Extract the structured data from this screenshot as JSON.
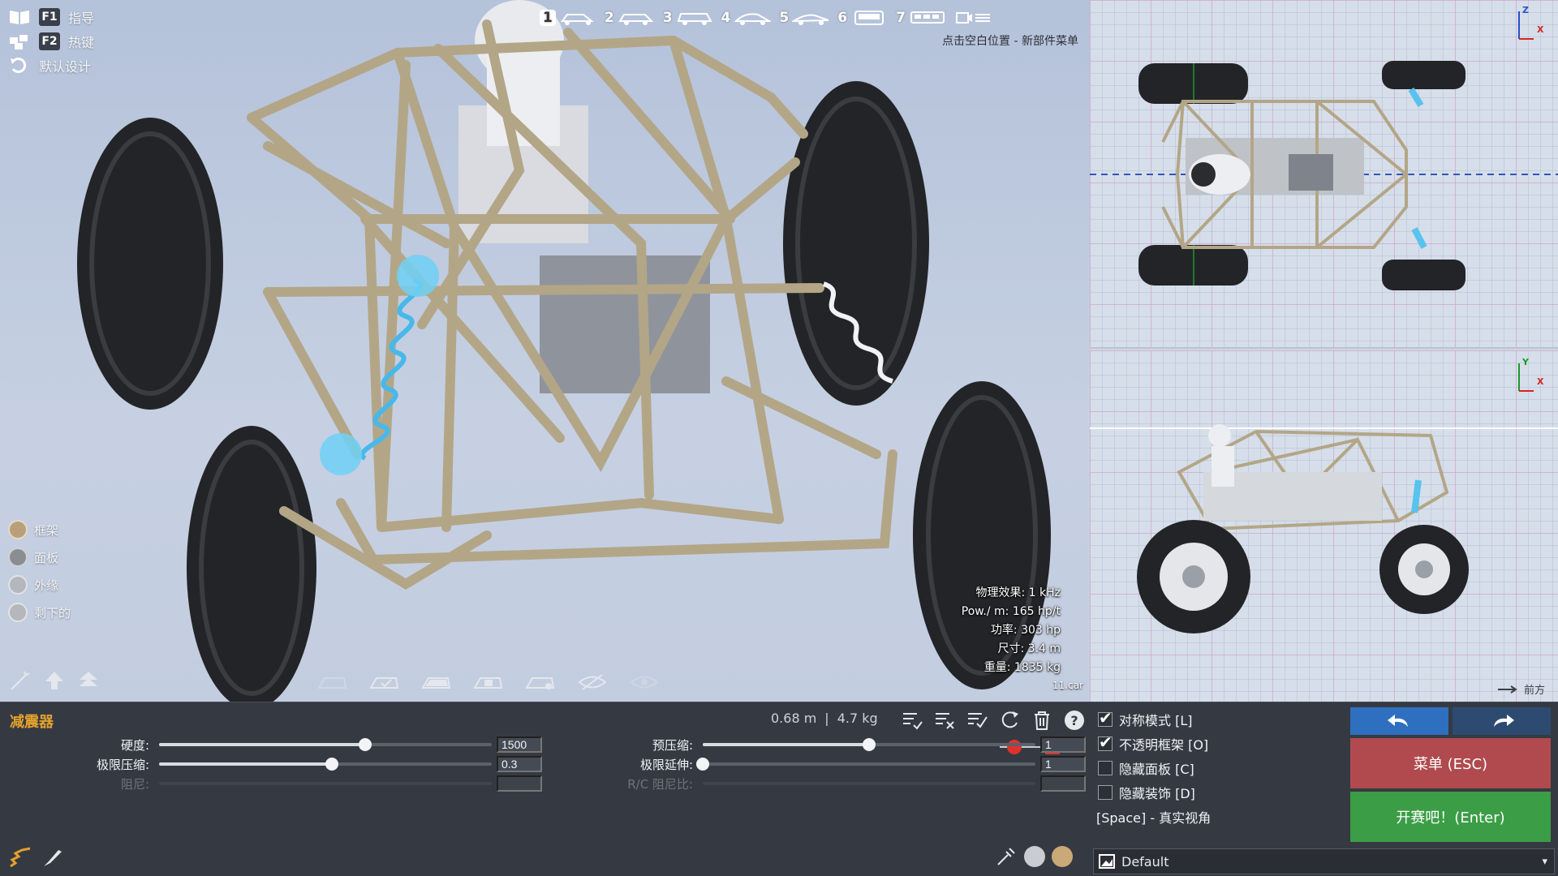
{
  "topleft": {
    "items": [
      {
        "key": "F1",
        "label": "指导"
      },
      {
        "key": "F2",
        "label": "热键"
      },
      {
        "key": "",
        "label": "默认设计"
      }
    ]
  },
  "vehicle_tabs": [
    {
      "num": "1",
      "icon": "buggy-icon"
    },
    {
      "num": "2",
      "icon": "sedan-icon"
    },
    {
      "num": "3",
      "icon": "wagon-icon"
    },
    {
      "num": "4",
      "icon": "coupe-icon"
    },
    {
      "num": "5",
      "icon": "sports-car-icon"
    },
    {
      "num": "6",
      "icon": "truck-front-icon"
    },
    {
      "num": "7",
      "icon": "bus-icon"
    }
  ],
  "hint_text": "点击空白位置 - 新部件菜单",
  "layers": [
    {
      "label": "框架",
      "color": "#b9a07a"
    },
    {
      "label": "面板",
      "color": "#8a8d92"
    },
    {
      "label": "外缘",
      "color": "#b4b7bb"
    },
    {
      "label": "剩下的",
      "color": "#b4b7bb"
    }
  ],
  "stats": [
    {
      "label": "物理效果:",
      "value": "1 kHz"
    },
    {
      "label": "Pow./ m:",
      "value": "165 hp/t"
    },
    {
      "label": "功率:",
      "value": "303 hp"
    },
    {
      "label": "尺寸:",
      "value": "3.4 m"
    },
    {
      "label": "重量:",
      "value": "1835 kg"
    }
  ],
  "filename": "11.car",
  "view_labels": {
    "top_axes": [
      "Z",
      "X"
    ],
    "side_axes": [
      "Y",
      "X"
    ],
    "forward": "前方"
  },
  "panel": {
    "title": "减震器",
    "length": "0.68 m",
    "separator": "|",
    "mass": "4.7 kg",
    "sliders_left": [
      {
        "label": "硬度:",
        "value": "1500",
        "level": 0.62,
        "enabled": true
      },
      {
        "label": "极限压缩:",
        "value": "0.3",
        "level": 0.52,
        "enabled": true
      },
      {
        "label": "阻尼:",
        "value": "",
        "level": 0,
        "enabled": false
      }
    ],
    "sliders_right": [
      {
        "label": "预压缩:",
        "value": "1",
        "level": 0.5,
        "enabled": true
      },
      {
        "label": "极限延伸:",
        "value": "1",
        "level": 0.0,
        "enabled": true
      },
      {
        "label": "R/C 阻尼比:",
        "value": "",
        "level": 0,
        "enabled": false
      }
    ],
    "colors": {
      "accent": "#e2a02e",
      "red": "#e0322b",
      "green": "#3b9d45",
      "blue": "#2e6fc0",
      "menu": "#b04a4e"
    }
  },
  "options": [
    {
      "label": "对称模式 [L]",
      "checked": true
    },
    {
      "label": "不透明框架 [O]",
      "checked": true
    },
    {
      "label": "隐藏面板 [C]",
      "checked": false
    },
    {
      "label": "隐藏装饰 [D]",
      "checked": false
    }
  ],
  "space_hint": "[Space] - 真实视角",
  "buttons": {
    "menu": "菜单 (ESC)",
    "start": "开赛吧！(Enter)"
  },
  "preset": "Default"
}
